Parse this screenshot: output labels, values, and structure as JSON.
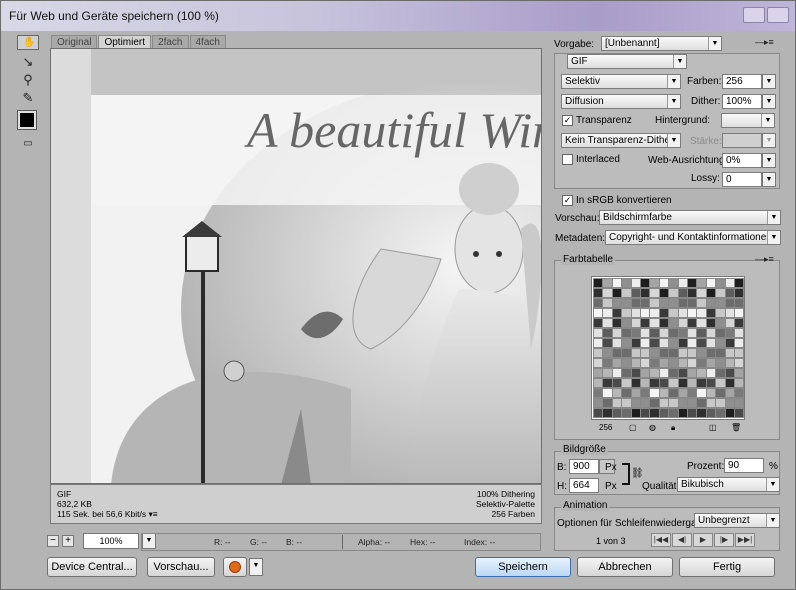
{
  "window": {
    "title": "Für Web und Geräte speichern (100 %)"
  },
  "tools": [
    {
      "name": "hand-tool-icon",
      "glyph": "✋"
    },
    {
      "name": "slice-select-icon",
      "glyph": "↖"
    },
    {
      "name": "zoom-tool-icon",
      "glyph": "🔍"
    },
    {
      "name": "eyedropper-icon",
      "glyph": "⁄"
    }
  ],
  "tabs": [
    {
      "label": "Original",
      "active": false
    },
    {
      "label": "Optimiert",
      "active": true
    },
    {
      "label": "2fach",
      "active": false
    },
    {
      "label": "4fach",
      "active": false
    }
  ],
  "preview": {
    "headline": "A beautiful Win"
  },
  "image_info": {
    "format": "GIF",
    "size": "632,2 KB",
    "download": "115 Sek. bei 56,6 Kbit/s",
    "dithering": "100% Dithering",
    "palette": "Selektiv-Palette",
    "colors": "256 Farben"
  },
  "zoom": {
    "value": "100%"
  },
  "status": {
    "r": "R: --",
    "g": "G: --",
    "b": "B: --",
    "alpha": "Alpha: --",
    "hex": "Hex: --",
    "index": "Index: --"
  },
  "buttons": {
    "device_central": "Device Central...",
    "preview": "Vorschau...",
    "save": "Speichern",
    "cancel": "Abbrechen",
    "done": "Fertig"
  },
  "settings": {
    "preset_label": "Vorgabe:",
    "preset_value": "[Unbenannt]",
    "format": "GIF",
    "reduction": "Selektiv",
    "colors_label": "Farben:",
    "colors_value": "256",
    "dither_algo": "Diffusion",
    "dither_label": "Dither:",
    "dither_value": "100%",
    "transparency_label": "Transparenz",
    "transparency_checked": true,
    "matte_label": "Hintergrund:",
    "transparency_dither": "Kein Transparenz-Dither",
    "amount_label": "Stärke:",
    "interlaced_label": "Interlaced",
    "interlaced_checked": false,
    "websnap_label": "Web-Ausrichtung:",
    "websnap_value": "0%",
    "lossy_label": "Lossy:",
    "lossy_value": "0",
    "srgb_label": "In sRGB konvertieren",
    "srgb_checked": true,
    "preview_label": "Vorschau:",
    "preview_value": "Bildschirmfarbe",
    "metadata_label": "Metadaten:",
    "metadata_value": "Copyright- und Kontaktinformationen"
  },
  "color_table": {
    "title": "Farbtabelle",
    "count": "256",
    "grays": [
      "#1e1e1e",
      "#4a4a4a",
      "#7a7a7a",
      "#a5a5a5",
      "#c8c8c8",
      "#e2e2e2",
      "#f5f5f5",
      "#2f2f2f",
      "#5d5d5d",
      "#8f8f8f",
      "#b7b7b7",
      "#d6d6d6",
      "#ededed",
      "#393939",
      "#6c6c6c"
    ]
  },
  "image_size": {
    "title": "Bildgröße",
    "w_label": "B:",
    "w_value": "900",
    "h_label": "H:",
    "h_value": "664",
    "unit": "Px",
    "percent_label": "Prozent:",
    "percent_value": "90",
    "percent_unit": "%",
    "quality_label": "Qualität:",
    "quality_value": "Bikubisch"
  },
  "animation": {
    "title": "Animation",
    "loop_label": "Optionen für Schleifenwiedergabe:",
    "loop_value": "Unbegrenzt",
    "frame_counter": "1 von 3"
  }
}
